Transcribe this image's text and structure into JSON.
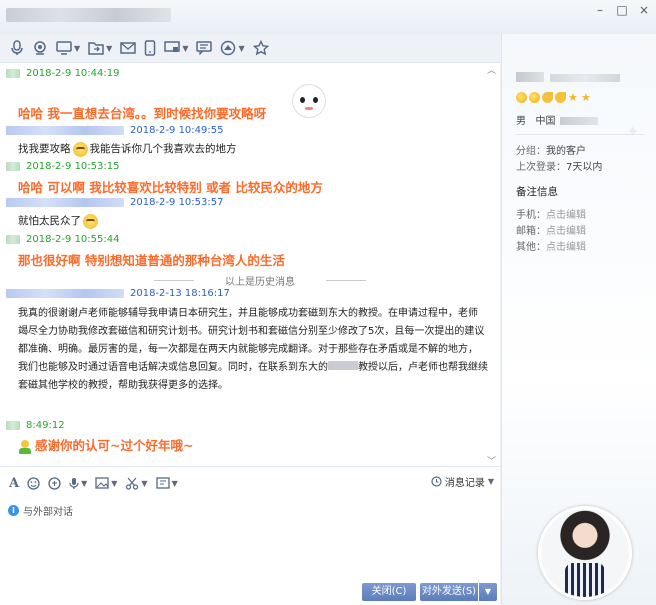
{
  "toolbar": {
    "icons": [
      "microphone-icon",
      "video-icon",
      "screen-share-icon",
      "file-transfer-icon",
      "mail-icon",
      "phone-icon",
      "remote-desktop-icon",
      "message-icon",
      "app-icon",
      "favorite-icon"
    ]
  },
  "messages": [
    {
      "sender": "self",
      "time": "2018-2-9 10:44:19",
      "text": "哈哈  我一直想去台湾。。到时候找你要攻略呀"
    },
    {
      "sender": "other",
      "time": "2018-2-9 10:49:55",
      "text_before": "找我要攻略",
      "text_after": "我能告诉你几个我喜欢去的地方"
    },
    {
      "sender": "self",
      "time": "2018-2-9 10:53:15",
      "text": "哈哈  可以啊  我比较喜欢比较特别  或者  比较民众的地方"
    },
    {
      "sender": "other",
      "time": "2018-2-9 10:53:57",
      "text": "就怕太民众了"
    },
    {
      "sender": "self",
      "time": "2018-2-9 10:55:44",
      "text": "那也很好啊  特别想知道普通的那种台湾人的生活"
    }
  ],
  "history_divider": "以上是历史消息",
  "long_message": {
    "time": "2018-2-13 18:16:17",
    "lines": [
      "我真的很谢谢卢老师能够辅导我申请日本研究生，并且能够成功套磁到东大的教授。在申请过程中，老师",
      "竭尽全力协助我修改套磁信和研究计划书。研究计划书和套磁信分别至少修改了5次，且每一次提出的建议",
      "都准确、明确。最厉害的是，每一次都是在两天内就能够完成翻译。对于那些存在矛盾或是不解的地方，",
      "我们也能够及时通过语音电话解决或信息回复。同时，在联系到东大的",
      "教授以后，卢老师也帮我继续",
      "套磁其他学校的教授，帮助我获得更多的选择。"
    ]
  },
  "last_message": {
    "time": "8:49:12",
    "text": "感谢你的认可~过个好年哦~"
  },
  "input_bar": {
    "message_log_label": "消息记录",
    "outside_hint": "与外部对话",
    "close_label": "关闭(C)",
    "send_label": "对外发送(S)"
  },
  "profile": {
    "gender": "男",
    "country": "中国",
    "group_label": "分组：",
    "group_value": "我的客户",
    "last_login_label": "上次登录：",
    "last_login_value": "7天以内",
    "remark_title": "备注信息",
    "phone_label": "手机：",
    "email_label": "邮箱：",
    "other_label": "其他：",
    "edit_hint": "点击编辑"
  },
  "colors": {
    "self_time": "#27a32e",
    "other_time": "#2a5fd0",
    "highlight_text": "#ff6a2a",
    "button": "#5b7bbd"
  }
}
